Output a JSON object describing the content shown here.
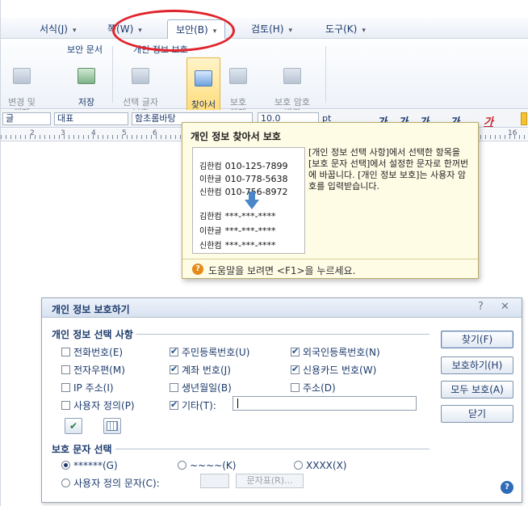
{
  "menubar": {
    "items": [
      {
        "label": "서식(J)",
        "arrow": "▾"
      },
      {
        "label": "쪽(W)",
        "arrow": "▾"
      },
      {
        "label": "보안(B)",
        "arrow": "▾"
      },
      {
        "label": "검토(H)",
        "arrow": "▾"
      },
      {
        "label": "도구(K)",
        "arrow": "▾"
      }
    ]
  },
  "ribbon": {
    "groups": [
      {
        "label": "보안 문서"
      },
      {
        "label": "개인 정보 보호"
      }
    ],
    "buttons": [
      {
        "label": "변경 및\n해제",
        "icon": "document-lock-icon"
      },
      {
        "label": "저장",
        "icon": "save-icon"
      },
      {
        "label": "선택 글자\n보호",
        "icon": "select-text-icon"
      },
      {
        "label": "찾아서\n보호",
        "icon": "find-protect-icon"
      },
      {
        "label": "보호\n해제",
        "icon": "unprotect-icon"
      },
      {
        "label": "보호 암호\n변경",
        "icon": "password-icon"
      }
    ]
  },
  "formatbar": {
    "style": "글",
    "lang": "대표",
    "font": "함초롬바탕",
    "size": "10.0",
    "unit": "pt",
    "styles": [
      "가",
      "가",
      "가",
      "가",
      "가"
    ]
  },
  "ruler": {
    "numbers": [
      "2",
      "3",
      "4",
      "5",
      "6",
      "16"
    ]
  },
  "tooltip": {
    "title": "개인 정보 찾아서 보호",
    "example": {
      "rows_before": [
        {
          "name": "김한컴",
          "value": "010-125-7899"
        },
        {
          "name": "이한글",
          "value": "010-778-5638"
        },
        {
          "name": "신한컴",
          "value": "010-756-8972"
        }
      ],
      "rows_after": [
        {
          "name": "김한컴",
          "value": "***-***-****"
        },
        {
          "name": "이한글",
          "value": "***-***-****"
        },
        {
          "name": "신한컴",
          "value": "***-***-****"
        }
      ]
    },
    "description": "[개인 정보 선택 사항]에서 선택한 항목을 [보호 문자 선택]에서 설정한 문자로 한꺼번에 바꿉니다. [개인 정보 보호]는 사용자 암호를 입력받습니다.",
    "help_icon": "?",
    "footer": "도움말을 보려면 <F1>을 누르세요."
  },
  "dialog": {
    "title": "개인 정보 보호하기",
    "controls": {
      "help": "?",
      "close": "✕"
    },
    "section1": "개인 정보 선택 사항",
    "checkboxes": [
      {
        "label": "전화번호(E)",
        "checked": false
      },
      {
        "label": "주민등록번호(U)",
        "checked": true
      },
      {
        "label": "외국인등록번호(N)",
        "checked": true
      },
      {
        "label": "전자우편(M)",
        "checked": false
      },
      {
        "label": "계좌 번호(J)",
        "checked": true
      },
      {
        "label": "신용카드 번호(W)",
        "checked": true
      },
      {
        "label": "IP 주소(I)",
        "checked": false
      },
      {
        "label": "생년월일(B)",
        "checked": false
      },
      {
        "label": "주소(D)",
        "checked": false
      },
      {
        "label": "사용자 정의(P)",
        "checked": false
      },
      {
        "label": "기타(T):",
        "checked": true
      }
    ],
    "other_value": "",
    "section2": "보호 문자 선택",
    "radios": [
      {
        "label": "******(G)",
        "checked": true
      },
      {
        "label": "~~~~(K)",
        "checked": false
      },
      {
        "label": "XXXX(X)",
        "checked": false
      },
      {
        "label": "사용자 정의 문자(C):",
        "checked": false
      }
    ],
    "custom_char": "",
    "charmap_button": "문자표(R)...",
    "buttons": {
      "find": "찾기(F)",
      "protect": "보호하기(H)",
      "protect_all": "모두 보호(A)",
      "close": "닫기"
    },
    "help_icon": "?"
  },
  "colors": {
    "accent": "#1c3a6b",
    "highlight": "#ffd76a",
    "annotation": "#e1232b",
    "tooltip_bg": "#fffce6"
  }
}
